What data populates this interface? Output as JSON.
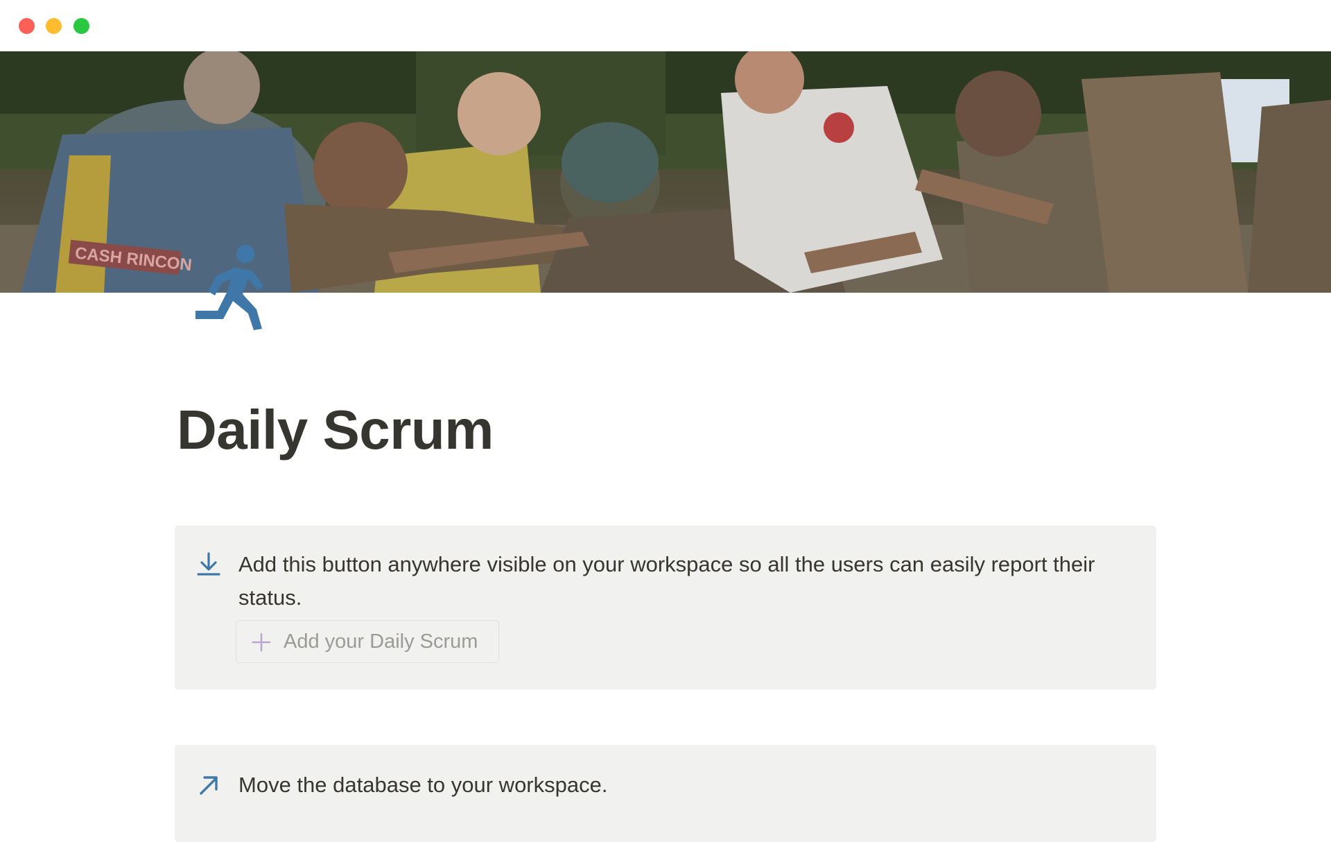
{
  "window": {
    "controls": [
      "close",
      "minimize",
      "zoom"
    ],
    "colors": {
      "close": "#fe5f57",
      "minimize": "#febc2e",
      "zoom": "#28c840"
    }
  },
  "cover": {
    "icon": "rugby-scrum-photo",
    "jersey_text": "CASH RINCON"
  },
  "page": {
    "icon": "running-person-icon",
    "icon_color": "#3f78a8",
    "title": "Daily Scrum"
  },
  "callouts": [
    {
      "icon": "download-arrow-icon",
      "text": "Add this button anywhere visible on your workspace so all the users can easily report their status.",
      "button": {
        "icon": "plus-icon",
        "label": "Add your Daily Scrum"
      }
    },
    {
      "icon": "arrow-up-right-icon",
      "text": "Move the database to your workspace."
    }
  ],
  "colors": {
    "text": "#37352f",
    "callout_bg": "#f1f1ef",
    "accent_blue": "#3f78a8",
    "button_text": "#9b9a97"
  }
}
